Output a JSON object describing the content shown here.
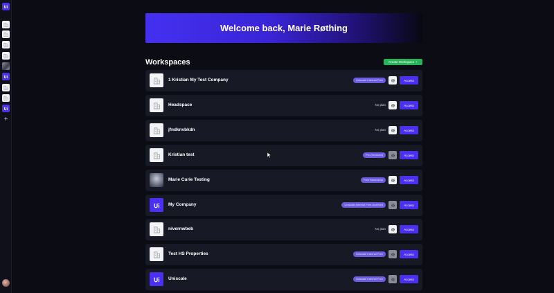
{
  "banner": {
    "title": "Welcome back, Marie Røthing"
  },
  "workspaces_heading": "Workspaces",
  "create_button": {
    "label": "Create Workspace",
    "icon": "plus-icon"
  },
  "colors": {
    "accent": "#4a31f2",
    "create_green": "#27b357",
    "badge_purple": "#6b5ce0",
    "row_bg": "#171925",
    "page_bg": "#0b0c14"
  },
  "workspaces": [
    {
      "name": "1 Kristian My Test Company",
      "plan": "Uniscale Internal Free",
      "plan_type": "badge",
      "logo": "building",
      "gear_dim": false,
      "access": "Access"
    },
    {
      "name": "Headspace",
      "plan": "No plan",
      "plan_type": "text",
      "logo": "building",
      "gear_dim": false,
      "access": "Access"
    },
    {
      "name": "jfndknvbkdn",
      "plan": "No plan",
      "plan_type": "text",
      "logo": "building",
      "gear_dim": false,
      "access": "Access"
    },
    {
      "name": "Kristian test",
      "plan": "Pro (Invoiced)",
      "plan_type": "badge",
      "logo": "building",
      "gear_dim": true,
      "access": "Access"
    },
    {
      "name": "Marie Curie Testing",
      "plan": "Free Basecamp",
      "plan_type": "badge",
      "logo": "photo",
      "gear_dim": false,
      "access": "Access"
    },
    {
      "name": "My Company",
      "plan": "Uniscale Internal Free Archived",
      "plan_type": "badge",
      "logo": "brand",
      "gear_dim": true,
      "access": "Access"
    },
    {
      "name": "nivernwbeb",
      "plan": "No plan",
      "plan_type": "text",
      "logo": "building",
      "gear_dim": false,
      "access": "Access"
    },
    {
      "name": "Test HS Properties",
      "plan": "Uniscale Internal Free",
      "plan_type": "badge",
      "logo": "building",
      "gear_dim": true,
      "access": "Access"
    },
    {
      "name": "Uniscale",
      "plan": "Uniscale Internal Free",
      "plan_type": "badge",
      "logo": "brand",
      "gear_dim": true,
      "access": "Access"
    }
  ],
  "sidebar": {
    "items": [
      {
        "icon": "uniscale-logo-icon",
        "type": "brand"
      },
      {
        "icon": "building-icon",
        "type": "building"
      },
      {
        "icon": "building-icon",
        "type": "building"
      },
      {
        "icon": "building-icon",
        "type": "building"
      },
      {
        "icon": "building-icon",
        "type": "building"
      },
      {
        "icon": "photo-icon",
        "type": "photo"
      },
      {
        "icon": "uniscale-logo-icon",
        "type": "brand"
      },
      {
        "icon": "building-icon",
        "type": "building"
      },
      {
        "icon": "building-icon",
        "type": "building"
      },
      {
        "icon": "uniscale-logo-icon",
        "type": "brand"
      }
    ],
    "add_icon": "plus-icon",
    "avatar_icon": "user-avatar-icon"
  }
}
